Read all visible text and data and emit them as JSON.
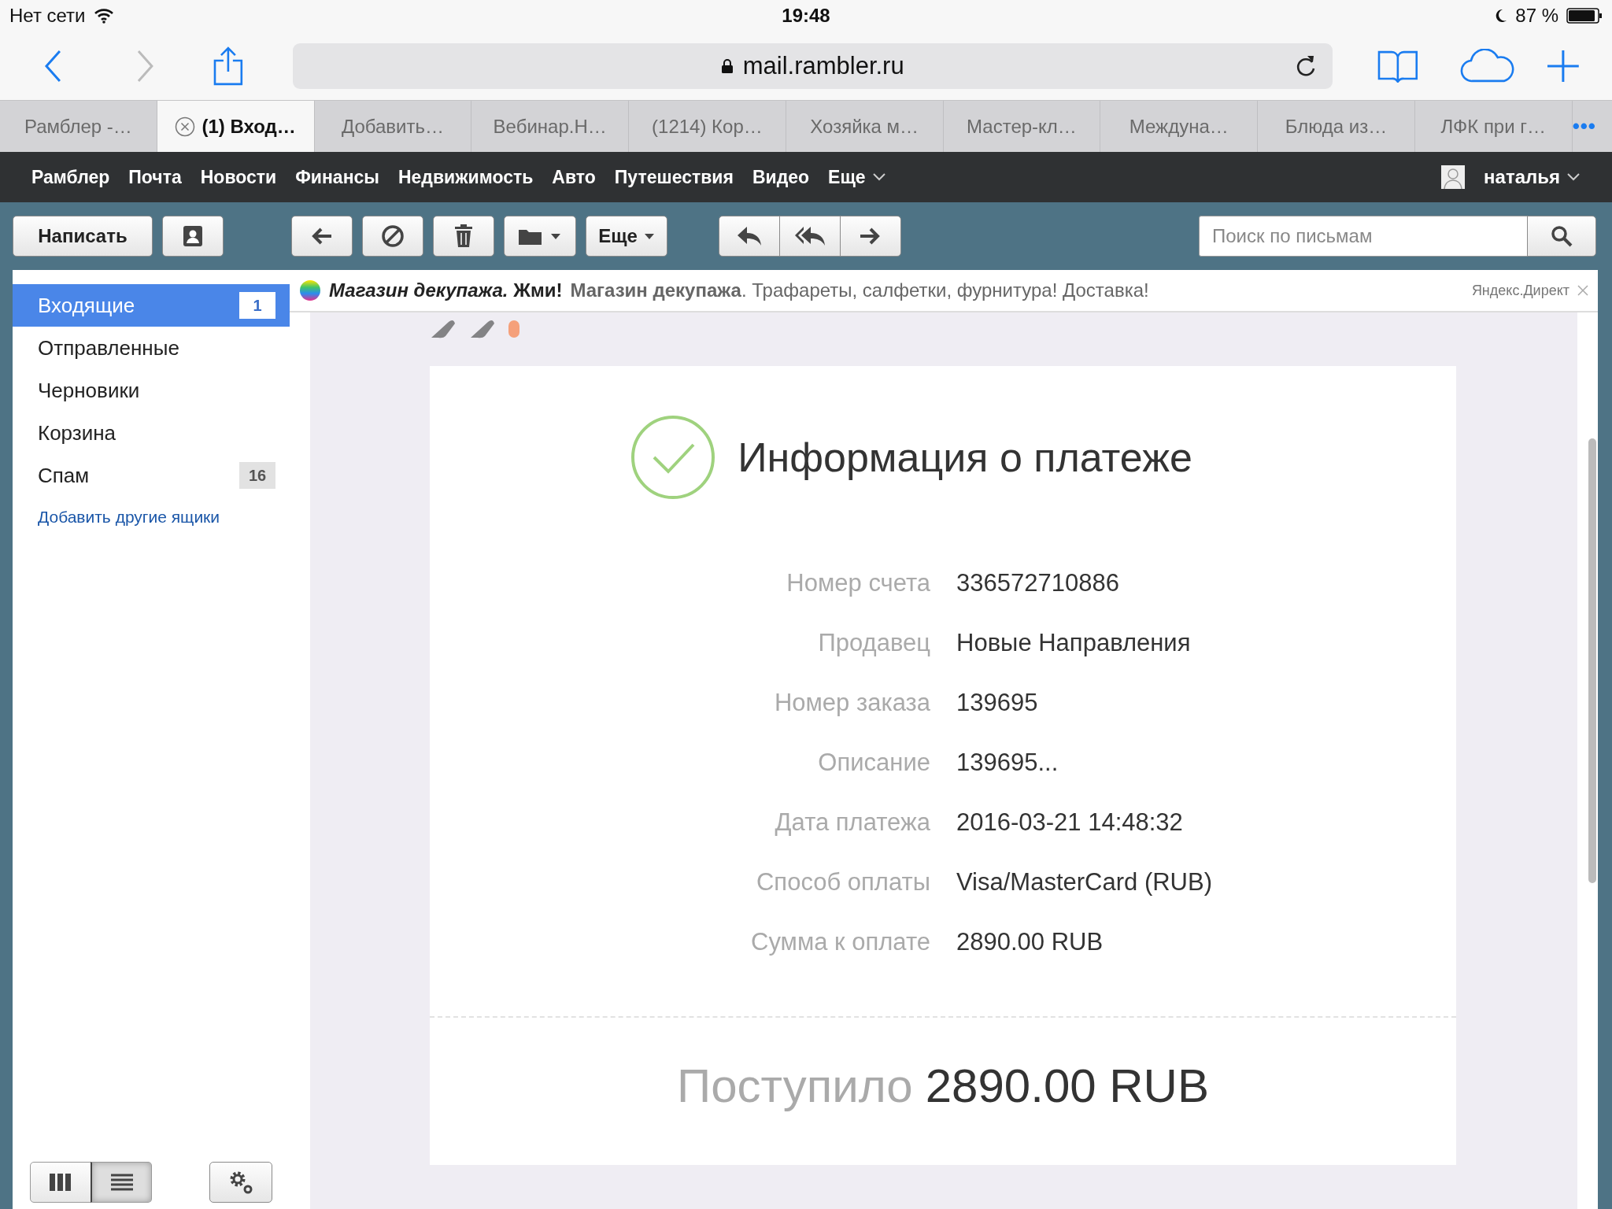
{
  "status_bar": {
    "carrier": "Нет сети",
    "time": "19:48",
    "battery": "87 %"
  },
  "browser": {
    "url": "mail.rambler.ru"
  },
  "tabs": [
    {
      "label": "Рамблер -…",
      "selected": false
    },
    {
      "label": "(1) Вход…",
      "selected": true
    },
    {
      "label": "Добавить…",
      "selected": false
    },
    {
      "label": "Вебинар.Н…",
      "selected": false
    },
    {
      "label": "(1214) Кор…",
      "selected": false
    },
    {
      "label": "Хозяйка м…",
      "selected": false
    },
    {
      "label": "Мастер-кл…",
      "selected": false
    },
    {
      "label": "Междуна…",
      "selected": false
    },
    {
      "label": "Блюда из…",
      "selected": false
    },
    {
      "label": "ЛФК при г…",
      "selected": false
    }
  ],
  "more_tabs": "•••",
  "nav": {
    "items": [
      "Рамблер",
      "Почта",
      "Новости",
      "Финансы",
      "Недвижимость",
      "Авто",
      "Путешествия",
      "Видео"
    ],
    "more": "Еще",
    "user": "наталья"
  },
  "toolbar": {
    "compose": "Написать",
    "more": "Еще",
    "search_placeholder": "Поиск по письмам"
  },
  "folders": [
    {
      "name": "Входящие",
      "count": "1",
      "selected": true
    },
    {
      "name": "Отправленные",
      "selected": false
    },
    {
      "name": "Черновики",
      "selected": false
    },
    {
      "name": "Корзина",
      "selected": false
    },
    {
      "name": "Спам",
      "count": "16",
      "selected": false
    }
  ],
  "add_mailboxes": "Добавить другие ящики",
  "view_modes": [
    {
      "kind": "columns",
      "selected": false
    },
    {
      "kind": "list",
      "selected": true
    }
  ],
  "ad": {
    "title": "*Магазин декупажа.* Жми!",
    "body": "**Магазин декупажа**. Трафареты, салфетки, фурнитура! Доставка!",
    "source": "Яндекс.Директ"
  },
  "payment": {
    "title": "Информация о платеже",
    "rows": [
      {
        "label": "Номер счета",
        "value": "336572710886"
      },
      {
        "label": "Продавец",
        "value": "Новые Направления"
      },
      {
        "label": "Номер заказа",
        "value": "139695"
      },
      {
        "label": "Описание",
        "value": "139695..."
      },
      {
        "label": "Дата платежа",
        "value": "2016-03-21 14:48:32"
      },
      {
        "label": "Способ оплаты",
        "value": "Visa/MasterCard (RUB)"
      },
      {
        "label": "Сумма к оплате",
        "value": "2890.00 RUB"
      }
    ],
    "total_label": "Поступило",
    "total_value": "2890.00 RUB"
  }
}
